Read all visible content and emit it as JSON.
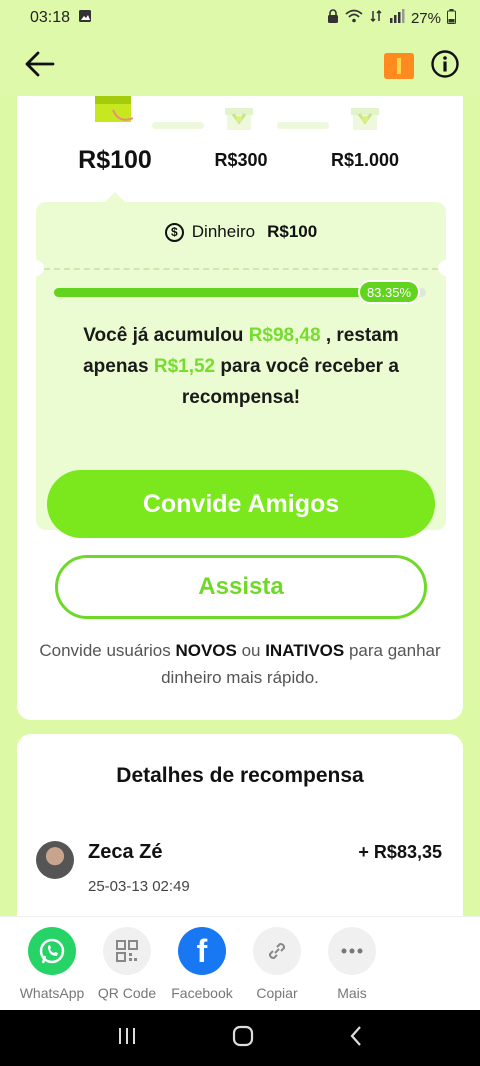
{
  "status": {
    "time": "03:18",
    "battery": "27%"
  },
  "tiers": [
    {
      "label": "R$100"
    },
    {
      "label": "R$300"
    },
    {
      "label": "R$1.000"
    }
  ],
  "reward": {
    "type_label": "Dinheiro",
    "amount": "R$100",
    "progress": "83.35%",
    "progress_value": 83.35,
    "text_1": "Você já acumulou ",
    "accumulated": "R$98,48",
    "text_2": " , restam apenas ",
    "remaining": "R$1,52",
    "text_3": " para você receber a recompensa!"
  },
  "buttons": {
    "invite": "Convide Amigos",
    "watch": "Assista"
  },
  "hint": {
    "t1": "Convide usuários ",
    "new": "NOVOS",
    "t2": " ou ",
    "inactive": "INATIVOS",
    "t3": " para ganhar dinheiro mais rápido."
  },
  "details": {
    "title": "Detalhes de recompensa",
    "entries": [
      {
        "name": "Zeca Zé",
        "date": "25-03-13 02:49",
        "amount": "+ R$83,35"
      }
    ]
  },
  "share": [
    {
      "label": "WhatsApp",
      "icon": "whatsapp-icon",
      "color": "#25d366"
    },
    {
      "label": "QR Code",
      "icon": "qr-code-icon",
      "color": "#f0f0f0"
    },
    {
      "label": "Facebook",
      "icon": "facebook-icon",
      "color": "#1877f2"
    },
    {
      "label": "Copiar",
      "icon": "link-icon",
      "color": "#f0f0f0"
    },
    {
      "label": "Mais",
      "icon": "more-icon",
      "color": "#f0f0f0"
    }
  ]
}
